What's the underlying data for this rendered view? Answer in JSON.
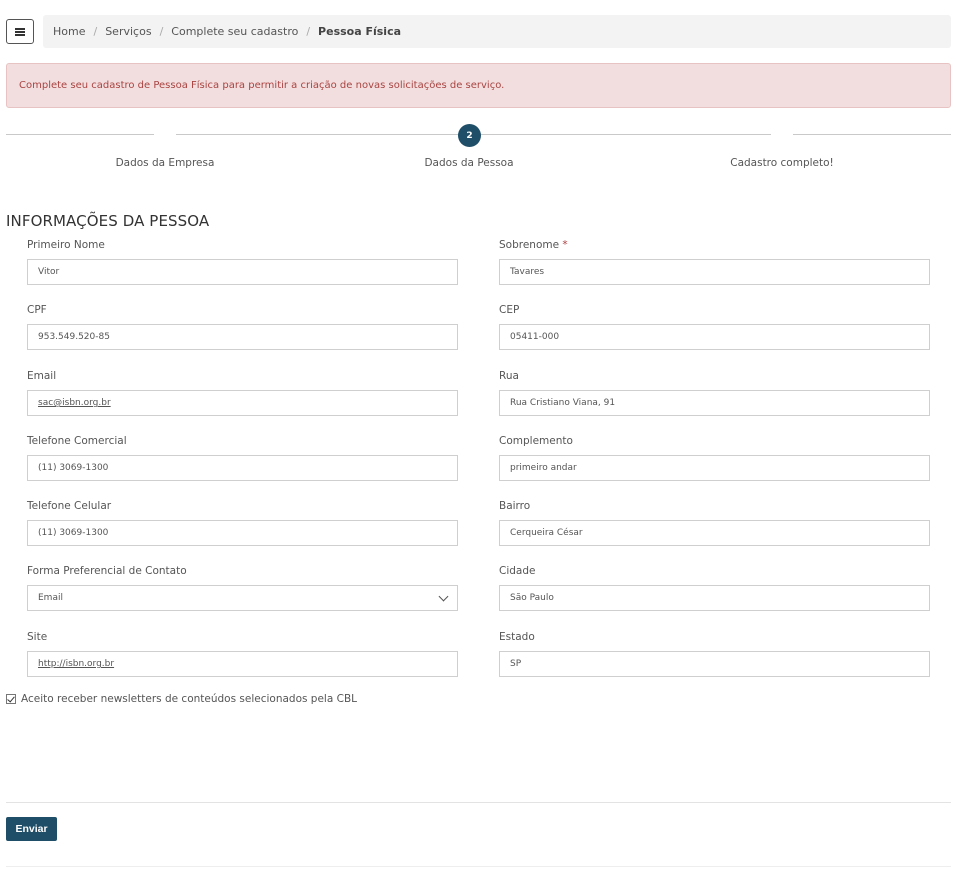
{
  "breadcrumb": {
    "items": [
      "Home",
      "Serviços",
      "Complete seu cadastro"
    ],
    "current": "Pessoa Física",
    "separator": "/"
  },
  "alert": {
    "text": "Complete seu cadastro de Pessoa Física para permitir a criação de novas solicitações de serviço."
  },
  "stepper": {
    "active_number": "2",
    "steps": [
      "Dados da Empresa",
      "Dados da Pessoa",
      "Cadastro completo!"
    ]
  },
  "section": {
    "title": "INFORMAÇÕES DA PESSOA"
  },
  "form": {
    "left": [
      {
        "label": "Primeiro Nome",
        "value": "Vitor"
      },
      {
        "label": "CPF",
        "value": "953.549.520-85"
      },
      {
        "label": "Email",
        "value": "sac@isbn.org.br"
      },
      {
        "label": "Telefone Comercial",
        "value": "(11) 3069-1300"
      },
      {
        "label": "Telefone Celular",
        "value": "(11) 3069-1300"
      },
      {
        "label": "Forma Preferencial de Contato",
        "value": "Email"
      },
      {
        "label": "Site",
        "value": "http://isbn.org.br"
      }
    ],
    "right": [
      {
        "label": "Sobrenome",
        "value": "Tavares",
        "required_mark": "*"
      },
      {
        "label": "CEP",
        "value": "05411-000"
      },
      {
        "label": "Rua",
        "value": "Rua Cristiano Viana, 91"
      },
      {
        "label": "Complemento",
        "value": "primeiro andar"
      },
      {
        "label": "Bairro",
        "value": "Cerqueira César"
      },
      {
        "label": "Cidade",
        "value": "São Paulo"
      },
      {
        "label": "Estado",
        "value": "SP"
      }
    ]
  },
  "newsletter": {
    "label": "Aceito receber newsletters de conteúdos selecionados pela CBL",
    "checked": true
  },
  "submit": {
    "label": "Enviar"
  },
  "colors": {
    "primary": "#1f4e68",
    "alert_bg": "#f2dede",
    "alert_text": "#a94442",
    "breadcrumb_bg": "#f3f3f3"
  },
  "icons": {
    "menu": "hamburger-icon",
    "select": "chevron-down-icon",
    "checkbox": "checkmark-icon"
  }
}
